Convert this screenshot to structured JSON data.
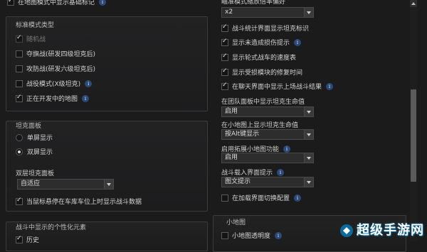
{
  "left": {
    "top_partial": "在地图模式中显示基础标记",
    "standard": {
      "title": "标准模式类型",
      "items": [
        {
          "label": "随机战",
          "checked": false,
          "disabled": true
        },
        {
          "label": "夺旗战(研发四级坦克后)",
          "checked": false
        },
        {
          "label": "攻防战(研发六级坦克后)",
          "checked": false
        },
        {
          "label": "战役模式(X级坦克)",
          "checked": false,
          "info": true
        },
        {
          "label": "正在开发中的地图",
          "checked": true,
          "info": true
        }
      ]
    },
    "tank_panel": {
      "title": "坦克面板",
      "radios": [
        {
          "label": "单屏显示",
          "selected": false
        },
        {
          "label": "双屏显示",
          "selected": true
        }
      ],
      "dual_title": "双层坦克面板",
      "dual_select": "自适应",
      "hover_checkbox": "当鼠标悬停在车库车位上时显示战斗数据"
    },
    "personal": {
      "title": "战斗中显示的个性化元素",
      "first_item": "历史"
    }
  },
  "right": {
    "top_partial": "瞄准模式缩放倍率偏好",
    "zoom_select": "x2",
    "checks": [
      {
        "label": "战斗统计界面显示坦克标识",
        "checked": true
      },
      {
        "label": "显示未造成损伤提示",
        "checked": true,
        "info": true
      },
      {
        "label": "显示轮式战车的速度表",
        "checked": true
      },
      {
        "label": "显示受损模块的修复时间",
        "checked": true
      },
      {
        "label": "在聊天界面中显示上场战斗结果",
        "checked": true,
        "info": true
      }
    ],
    "team_panel_label": "在团队面板中显示坦克生命值",
    "team_panel_select": "启用",
    "minimap_hp_label": "在小地图上显示坦克生命值",
    "minimap_hp_select": "按Alt键显示",
    "ext_minimap_label": "启用拓展小地图功能",
    "ext_minimap_select": "启用",
    "loading_tips_label": "战斗载入界面提示",
    "loading_tips_select": "图文提示",
    "loading_switch": "在加载界面切换配置",
    "minimap_title": "小地图",
    "minimap_opacity": "小地图透明度"
  },
  "watermark": "超级手游网"
}
